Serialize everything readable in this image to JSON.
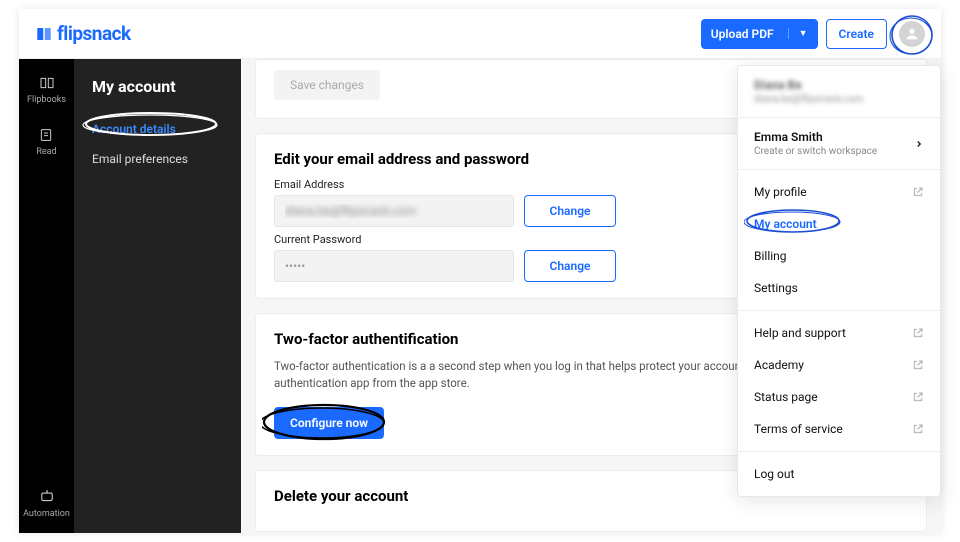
{
  "brand": {
    "name": "flipsnack"
  },
  "topbar": {
    "upload_label": "Upload PDF",
    "create_label": "Create"
  },
  "leftrail": {
    "items": [
      {
        "label": "Flipbooks"
      },
      {
        "label": "Read"
      }
    ],
    "bottom": {
      "label": "Automation"
    }
  },
  "sidebar": {
    "title": "My account",
    "links": [
      {
        "label": "Account details",
        "active": true
      },
      {
        "label": "Email preferences",
        "active": false
      }
    ]
  },
  "main": {
    "save_label": "Save changes",
    "edit_section": {
      "title": "Edit your email address and password",
      "email_label": "Email Address",
      "email_value": "diana.be@flipsnack.com",
      "password_label": "Current Password",
      "password_value": "•••••",
      "change_label": "Change"
    },
    "twofa": {
      "title": "Two-factor authentification",
      "desc": "Two-factor authentication is a a second step when you log in that helps protect your account. To set this up, install an authentication app from the app store.",
      "button": "Configure now"
    },
    "delete": {
      "title": "Delete your account"
    }
  },
  "dropdown": {
    "header_name": "Diana Be",
    "header_email": "diana.be@flipsnack.com",
    "workspace": {
      "name": "Emma Smith",
      "sub": "Create or switch workspace"
    },
    "group1": [
      {
        "label": "My profile",
        "external": true
      },
      {
        "label": "My account",
        "active": true
      },
      {
        "label": "Billing"
      },
      {
        "label": "Settings"
      }
    ],
    "group2": [
      {
        "label": "Help and support",
        "external": true
      },
      {
        "label": "Academy",
        "external": true
      },
      {
        "label": "Status page",
        "external": true
      },
      {
        "label": "Terms of service",
        "external": true
      }
    ],
    "logout": {
      "label": "Log out"
    }
  }
}
